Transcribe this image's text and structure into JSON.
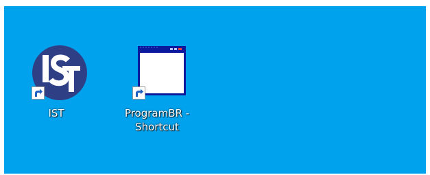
{
  "desktop": {
    "background_color": "#00a2ed",
    "icons": [
      {
        "label": "IST",
        "icon": "ist-logo-icon",
        "shortcut": true
      },
      {
        "label": "ProgramBR - Shortcut",
        "icon": "application-window-icon",
        "shortcut": true
      }
    ]
  },
  "colors": {
    "ist_logo_circle": "#2e3f86",
    "window_titlebar": "#0b1a9c"
  }
}
